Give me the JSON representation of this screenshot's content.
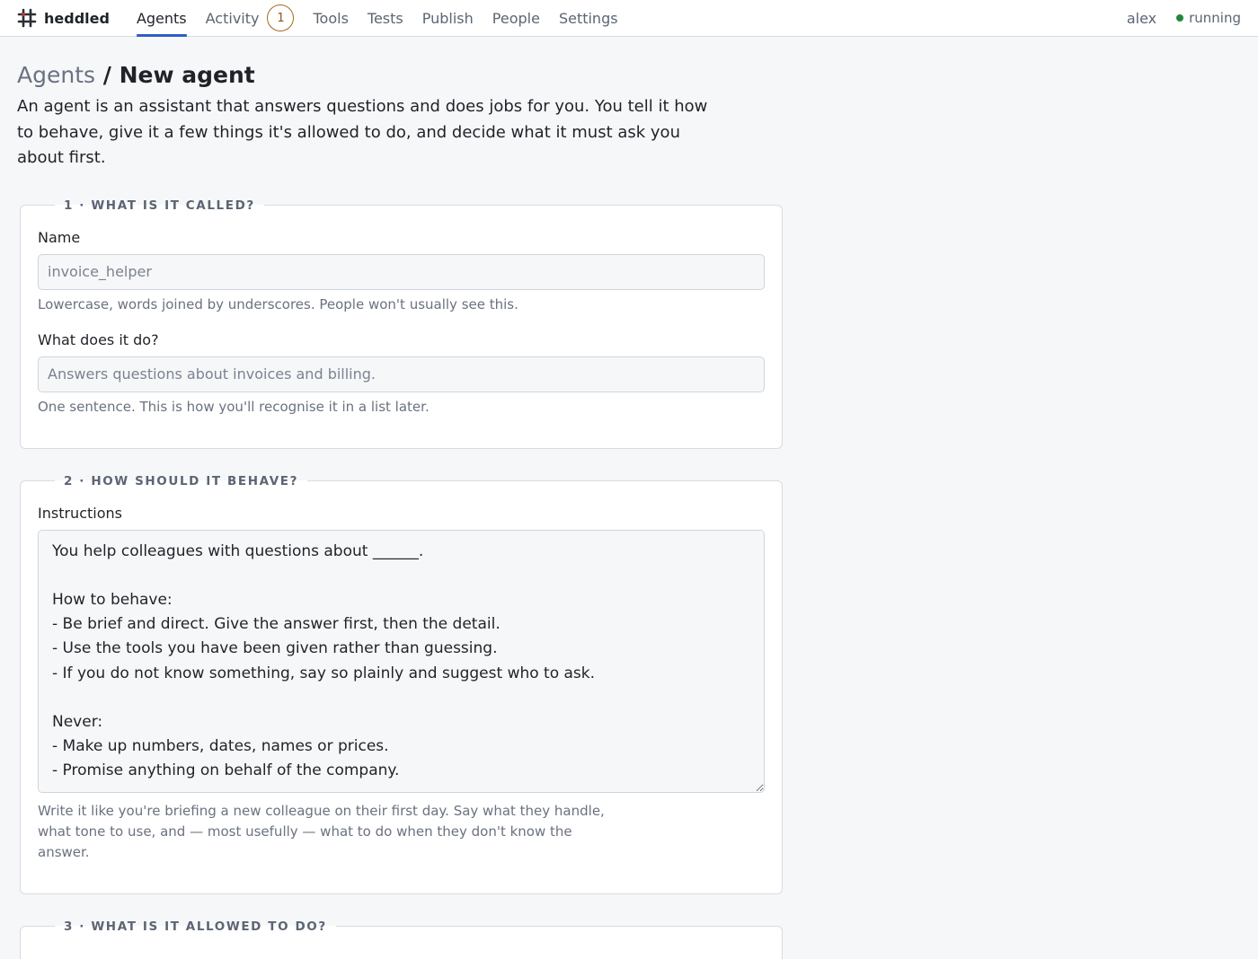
{
  "brand": {
    "name": "heddled",
    "icon": "hash-grid-icon"
  },
  "nav": {
    "items": [
      {
        "label": "Agents",
        "active": true
      },
      {
        "label": "Activity",
        "badge": "1"
      },
      {
        "label": "Tools"
      },
      {
        "label": "Tests"
      },
      {
        "label": "Publish"
      },
      {
        "label": "People"
      },
      {
        "label": "Settings"
      }
    ]
  },
  "user": {
    "name": "alex",
    "status": "running",
    "status_color": "#1f8a3b"
  },
  "page": {
    "breadcrumb_parent": "Agents",
    "breadcrumb_sep": "/",
    "title": "New agent",
    "intro": "An agent is an assistant that answers questions and does jobs for you. You tell it how to behave, give it a few things it's allowed to do, and decide what it must ask you about first."
  },
  "sections": [
    {
      "legend": "1 · WHAT IS IT CALLED?",
      "name_label": "Name",
      "name_placeholder": "invoice_helper",
      "name_hint": "Lowercase, words joined by underscores. People won't usually see this.",
      "desc_label": "What does it do?",
      "desc_placeholder": "Answers questions about invoices and billing.",
      "desc_hint": "One sentence. This is how you'll recognise it in a list later."
    },
    {
      "legend": "2 · HOW SHOULD IT BEHAVE?",
      "instructions_label": "Instructions",
      "instructions_value": "You help colleagues with questions about ______.\n\nHow to behave:\n- Be brief and direct. Give the answer first, then the detail.\n- Use the tools you have been given rather than guessing.\n- If you do not know something, say so plainly and suggest who to ask.\n\nNever:\n- Make up numbers, dates, names or prices.\n- Promise anything on behalf of the company.",
      "instructions_hint": "Write it like you're briefing a new colleague on their first day. Say what they handle, what tone to use, and — most usefully — what to do when they don't know the answer."
    },
    {
      "legend": "3 · WHAT IS IT ALLOWED TO DO?"
    }
  ],
  "colors": {
    "accent": "#2f5fc4",
    "badge": "#a66a1e"
  }
}
